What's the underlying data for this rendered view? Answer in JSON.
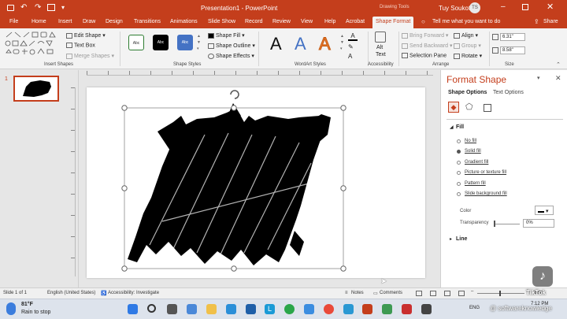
{
  "titlebar": {
    "title": "Presentation1  -  PowerPoint",
    "context": "Drawing Tools",
    "user": "Tuy Soukot",
    "initials": "TS"
  },
  "tabs": [
    "File",
    "Home",
    "Insert",
    "Draw",
    "Design",
    "Transitions",
    "Animations",
    "Slide Show",
    "Record",
    "Review",
    "View",
    "Help",
    "Acrobat",
    "Shape Format"
  ],
  "tell_me": "Tell me what you want to do",
  "share": "Share",
  "ribbon": {
    "insert_shapes": {
      "edit_shape": "Edit Shape",
      "text_box": "Text Box",
      "merge_shapes": "Merge Shapes",
      "label": "Insert Shapes"
    },
    "shape_styles": {
      "swatches": [
        "Abc",
        "Abc",
        "Abc"
      ],
      "fill": "Shape Fill",
      "outline": "Shape Outline",
      "effects": "Shape Effects",
      "label": "Shape Styles"
    },
    "wordart": {
      "letters": [
        "A",
        "A",
        "A"
      ],
      "label": "WordArt Styles"
    },
    "accessibility": {
      "alt_text_1": "Alt",
      "alt_text_2": "Text",
      "label": "Accessibility"
    },
    "arrange": {
      "bring_forward": "Bring Forward",
      "send_backward": "Send Backward",
      "selection_pane": "Selection Pane",
      "align": "Align",
      "group": "Group",
      "rotate": "Rotate",
      "label": "Arrange"
    },
    "size": {
      "height": "6.31\"",
      "width": "8.58\"",
      "label": "Size"
    }
  },
  "thumbnail": {
    "number": "1"
  },
  "pane": {
    "title": "Format Shape",
    "tabs": [
      "Shape Options",
      "Text Options"
    ],
    "fill_section": "Fill",
    "fill_options": [
      "No fill",
      "Solid fill",
      "Gradient fill",
      "Picture or texture fill",
      "Pattern fill",
      "Slide background fill"
    ],
    "selected_fill": 1,
    "color_label": "Color",
    "transparency_label": "Transparency",
    "transparency_value": "0%",
    "line_section": "Line"
  },
  "status": {
    "slide": "Slide 1 of 1",
    "language": "English (United States)",
    "accessibility": "Accessibility: Investigate",
    "notes": "Notes",
    "comments": "Comments",
    "zoom": "52%"
  },
  "taskbar": {
    "temp": "81°F",
    "weather": "Rain to stop",
    "time": "7:12 PM",
    "lang": "ENG"
  },
  "watermark": {
    "app": "TikTok",
    "handle": "@ softwareknowledge"
  }
}
